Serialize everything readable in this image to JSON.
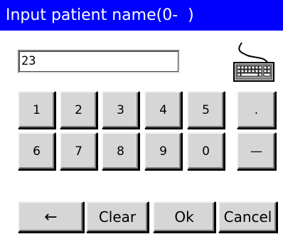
{
  "dialog": {
    "title": "Input patient name(0-  )",
    "input_value": "23"
  },
  "keypad": {
    "row1": [
      "1",
      "2",
      "3",
      "4",
      "5",
      "."
    ],
    "row2": [
      "6",
      "7",
      "8",
      "9",
      "0",
      "—"
    ],
    "backspace_label": "←",
    "clear_label": "Clear",
    "ok_label": "Ok",
    "cancel_label": "Cancel"
  },
  "icons": {
    "keyboard": "keyboard-icon"
  },
  "colors": {
    "titlebar": "#0000ff",
    "title_text": "#ffffff",
    "button_face": "#d6d6d6"
  }
}
